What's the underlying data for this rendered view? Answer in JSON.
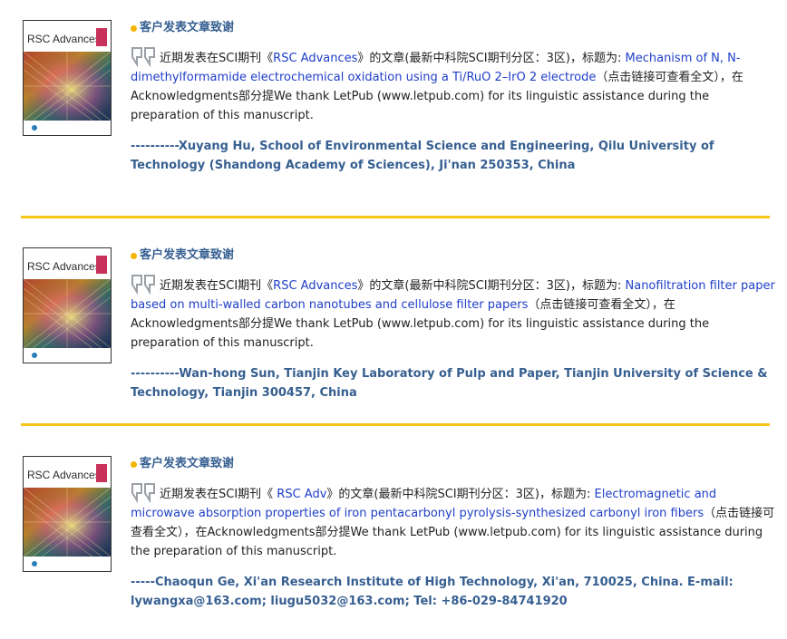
{
  "entries": [
    {
      "cover_title": "RSC Advances",
      "heading": "客户发表文章致谢",
      "intro": "近期发表在SCI期刊《",
      "journal": "RSC Advances",
      "intro2": "》的文章(最新中科院SCI期刊分区：3区)，标题为: ",
      "article_title": "Mechanism of N, N-dimethylformamide electrochemical oxidation using a Ti/RuO 2–IrO 2 electrode",
      "tail": "（点击链接可查看全文），在Acknowledgments部分提We thank LetPub (www.letpub.com) for its linguistic assistance during the preparation of this manuscript.",
      "author": "----------Xuyang Hu, School of Environmental Science and Engineering, Qilu University of Technology (Shandong Academy of Sciences), Ji'nan 250353, China"
    },
    {
      "cover_title": "RSC Advances",
      "heading": "客户发表文章致谢",
      "intro": "近期发表在SCI期刊《",
      "journal": "RSC Advances",
      "intro2": "》的文章(最新中科院SCI期刊分区：3区)，标题为: ",
      "article_title": "Nanofiltration filter paper based on multi-walled carbon nanotubes and cellulose filter papers",
      "tail": "（点击链接可查看全文），在Acknowledgments部分提We thank LetPub (www.letpub.com) for its linguistic assistance during the preparation of this manuscript.",
      "author": "----------Wan-hong Sun, Tianjin Key Laboratory of Pulp and Paper, Tianjin University of Science & Technology, Tianjin 300457, China"
    },
    {
      "cover_title": "RSC Advances",
      "heading": "客户发表文章致谢",
      "intro": "近期发表在SCI期刊《 ",
      "journal": "RSC Adv",
      "intro2": "》的文章(最新中科院SCI期刊分区：3区)，标题为: ",
      "article_title": "Electromagnetic and microwave absorption properties of iron pentacarbonyl pyrolysis-synthesized carbonyl iron fibers",
      "tail": "（点击链接可查看全文），在Acknowledgments部分提We thank LetPub (www.letpub.com) for its linguistic assistance during the preparation of this manuscript.",
      "author": "-----Chaoqun Ge, Xi'an Research Institute of High Technology, Xi'an, 710025, China. E-mail: lywangxa@163.com; liugu5032@163.com; Tel: +86-029-84741920"
    }
  ],
  "colors": {
    "heading": "#365f91",
    "link": "#1f3fc8",
    "divider": "#f5c518",
    "dot": "#f5b400"
  },
  "icons": {
    "bullet": "bullet-dot-icon",
    "quote": "quote-icon"
  }
}
